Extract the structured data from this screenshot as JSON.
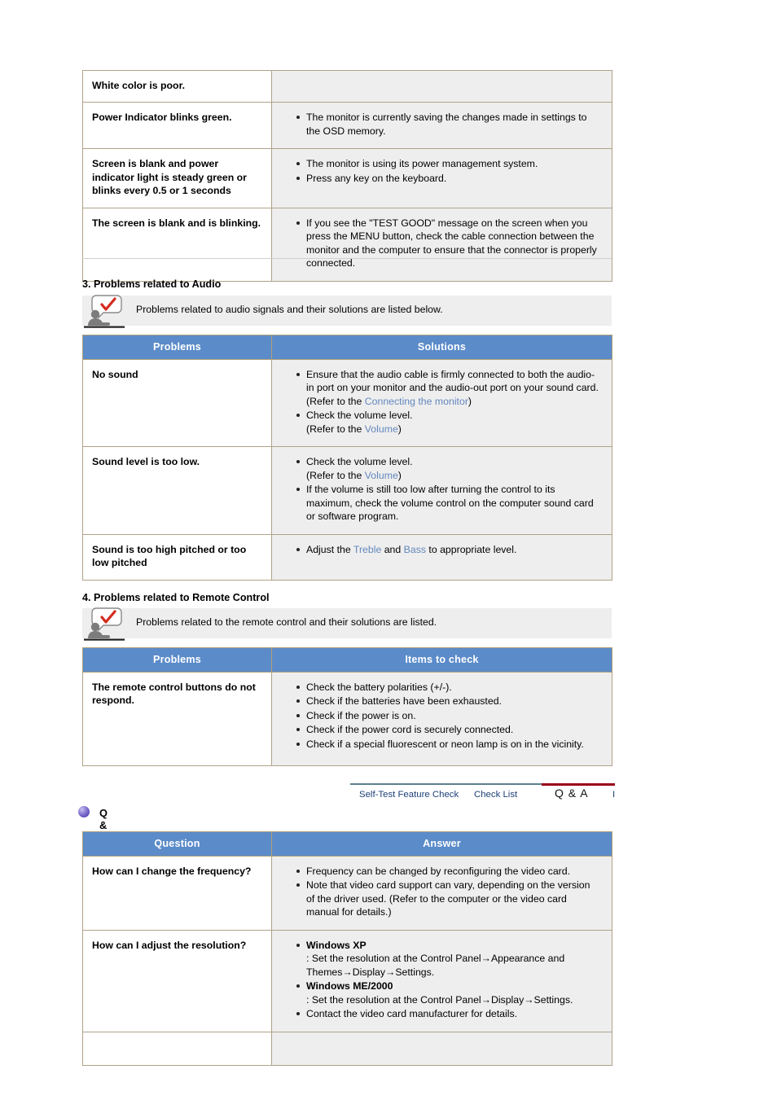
{
  "colors": {
    "table_header_bg": "#5b8bc9",
    "table_border": "#b0a289",
    "answer_cell_bg": "#eeeeee",
    "link_blue": "#6387bd",
    "nav_link": "#1c3f77",
    "nav_active_bar": "#990019",
    "nav_rule": "#5d7f8e",
    "qa_bullet": "#5b45b5"
  },
  "video_table": {
    "rows": [
      {
        "problem": "White color is poor.",
        "solutions": []
      },
      {
        "problem": "Power Indicator blinks green.",
        "solutions": [
          "The monitor is currently saving the changes made in settings to the OSD memory."
        ]
      },
      {
        "problem": "Screen is blank and power indicator light is steady green or blinks every 0.5 or 1 seconds",
        "solutions": [
          "The monitor is using its power management system.",
          "Press any key on the keyboard."
        ]
      },
      {
        "problem": "The screen is blank and is blinking.",
        "solutions": [
          "If you see the \"TEST GOOD\" message on the screen when you press the MENU button, check the cable connection between the monitor and the computer to ensure that the connector is properly connected."
        ]
      }
    ]
  },
  "audio_section": {
    "heading": "3. Problems related to Audio",
    "note_icon": "person-speech-check-icon",
    "note": "Problems related to audio signals and their solutions are listed below.",
    "headers": {
      "col1": "Problems",
      "col2": "Solutions"
    },
    "rows": [
      {
        "problem": "No sound",
        "solutions": [
          {
            "parts": [
              {
                "t": "Ensure that the audio cable is firmly connected to both the audio-in port on your monitor and the audio-out port on your sound card."
              },
              {
                "t": "(Refer to the ",
                "br": true
              },
              {
                "t": "Connecting the monitor",
                "link": true
              },
              {
                "t": ")"
              }
            ]
          },
          {
            "parts": [
              {
                "t": "Check the volume level."
              },
              {
                "t": "(Refer to the ",
                "br": true
              },
              {
                "t": "Volume",
                "link": true
              },
              {
                "t": ")"
              }
            ]
          }
        ]
      },
      {
        "problem": "Sound level is too low.",
        "solutions": [
          {
            "parts": [
              {
                "t": "Check the volume level."
              },
              {
                "t": "(Refer to the ",
                "br": true
              },
              {
                "t": "Volume",
                "link": true
              },
              {
                "t": ")"
              }
            ]
          },
          {
            "parts": [
              {
                "t": "If the volume is still too low after turning the control to its maximum, check the volume control on the computer sound card or software program."
              }
            ]
          }
        ]
      },
      {
        "problem": "Sound is too high pitched or too low pitched",
        "solutions": [
          {
            "parts": [
              {
                "t": "Adjust the "
              },
              {
                "t": "Treble",
                "link": true
              },
              {
                "t": " and "
              },
              {
                "t": "Bass",
                "link": true
              },
              {
                "t": " to appropriate level."
              }
            ]
          }
        ]
      }
    ]
  },
  "remote_section": {
    "heading": "4. Problems related to Remote Control",
    "note_icon": "person-speech-check-icon",
    "note": "Problems related to the remote control and their solutions are listed.",
    "headers": {
      "col1": "Problems",
      "col2": "Items to check"
    },
    "rows": [
      {
        "problem": "The remote control buttons do not respond.",
        "solutions": [
          "Check the battery polarities (+/-).",
          "Check if the batteries have been exhausted.",
          "Check if the power is on.",
          "Check if the power cord is securely connected.",
          "Check if a special fluorescent or neon lamp is on in the vicinity."
        ]
      }
    ]
  },
  "nav": {
    "tabs": [
      {
        "label": "Self-Test Feature Check",
        "active": false
      },
      {
        "label": "Check List",
        "active": false
      },
      {
        "label": "Q & A",
        "active": true
      },
      {
        "label": "I",
        "active": false
      }
    ]
  },
  "qa_section": {
    "bullet_icon": "sphere-bullet-icon",
    "heading": "Q & A",
    "headers": {
      "col1": "Question",
      "col2": "Answer"
    },
    "rows": [
      {
        "question": "How can I change the frequency?",
        "answers": [
          {
            "parts": [
              {
                "t": "Frequency can be changed by reconfiguring the video card."
              }
            ]
          },
          {
            "parts": [
              {
                "t": "Note that video card support can vary, depending on the version of the driver used. (Refer to the computer or the video card manual for details.)"
              }
            ]
          }
        ]
      },
      {
        "question": "How can I adjust the resolution?",
        "answers": [
          {
            "parts": [
              {
                "t": "Windows XP",
                "bold": true
              },
              {
                "t": ": Set the resolution at the Control Panel→Appearance and Themes→Display→Settings.",
                "br": true
              }
            ]
          },
          {
            "parts": [
              {
                "t": "Windows ME/2000",
                "bold": true
              },
              {
                "t": ": Set the resolution at the Control Panel→Display→Settings.",
                "br": true
              }
            ]
          },
          {
            "parts": [
              {
                "t": "Contact the video card manufacturer for details."
              }
            ]
          }
        ]
      },
      {
        "question": "",
        "answers": []
      }
    ]
  }
}
